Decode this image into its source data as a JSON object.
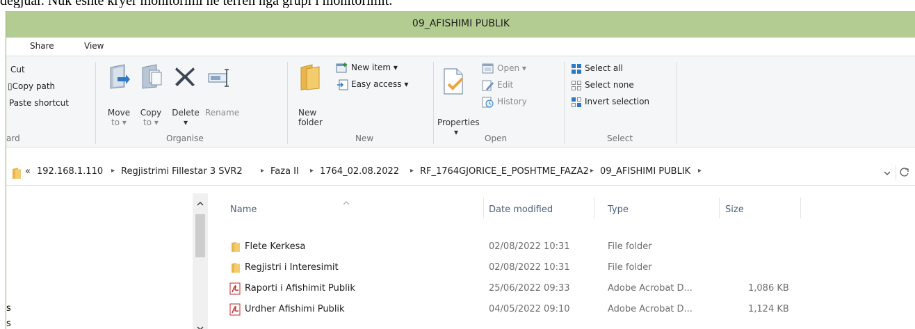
{
  "document_text": "dëgjuar. Nuk është kryer monitorimi në terren nga grupi i monitorimit.",
  "window": {
    "title": "09_AFISHIMI PUBLIK"
  },
  "tabs": [
    "Share",
    "View"
  ],
  "ribbon": {
    "clipboard": {
      "cut": "Cut",
      "copy_path": "Copy path",
      "paste_shortcut": "Paste shortcut",
      "label": "ard"
    },
    "organise": {
      "move_to": "Move",
      "move_to_2": "to ▾",
      "copy_to": "Copy",
      "copy_to_2": "to ▾",
      "delete": "Delete",
      "delete_arrow": "▾",
      "rename": "Rename",
      "label": "Organise"
    },
    "new": {
      "new_folder": "New",
      "new_folder_2": "folder",
      "new_item": "New item ▾",
      "easy_access": "Easy access ▾",
      "label": "New"
    },
    "open": {
      "properties": "Properties",
      "properties_arrow": "▾",
      "open": "Open ▾",
      "edit": "Edit",
      "history": "History",
      "label": "Open"
    },
    "select": {
      "select_all": "Select all",
      "select_none": "Select none",
      "invert": "Invert selection",
      "label": "Select"
    }
  },
  "address": {
    "overflow": "«",
    "segments": [
      "192.168.1.110",
      "Regjistrimi Fillestar 3 SVR2",
      "Faza II",
      "1764_02.08.2022",
      "RF_1764GJORICE_E_POSHTME_FAZA2",
      "09_AFISHIMI PUBLIK"
    ],
    "dropdown_icon": "chevron-down-icon",
    "refresh_icon": "refresh-icon"
  },
  "nav_pane": {
    "items": [
      "s",
      "s"
    ]
  },
  "columns": {
    "name": "Name",
    "date": "Date modified",
    "type": "Type",
    "size": "Size"
  },
  "files": [
    {
      "name": "Flete Kerkesa",
      "date": "02/08/2022 10:31",
      "type": "File folder",
      "size": "",
      "icon": "folder-icon"
    },
    {
      "name": "Regjistri i Interesimit",
      "date": "02/08/2022 10:31",
      "type": "File folder",
      "size": "",
      "icon": "folder-icon"
    },
    {
      "name": "Raporti i Afishimit Publik",
      "date": "25/06/2022 09:33",
      "type": "Adobe Acrobat D...",
      "size": "1,086 KB",
      "icon": "pdf-icon"
    },
    {
      "name": "Urdher Afishimi Publik",
      "date": "04/05/2022 09:10",
      "type": "Adobe Acrobat D...",
      "size": "1,124 KB",
      "icon": "pdf-icon"
    }
  ],
  "colors": {
    "titlebar": "#b2cc91",
    "ribbon_bg": "#f5f6f7",
    "folder": "#e8b64a",
    "pdf": "#c0282b"
  }
}
